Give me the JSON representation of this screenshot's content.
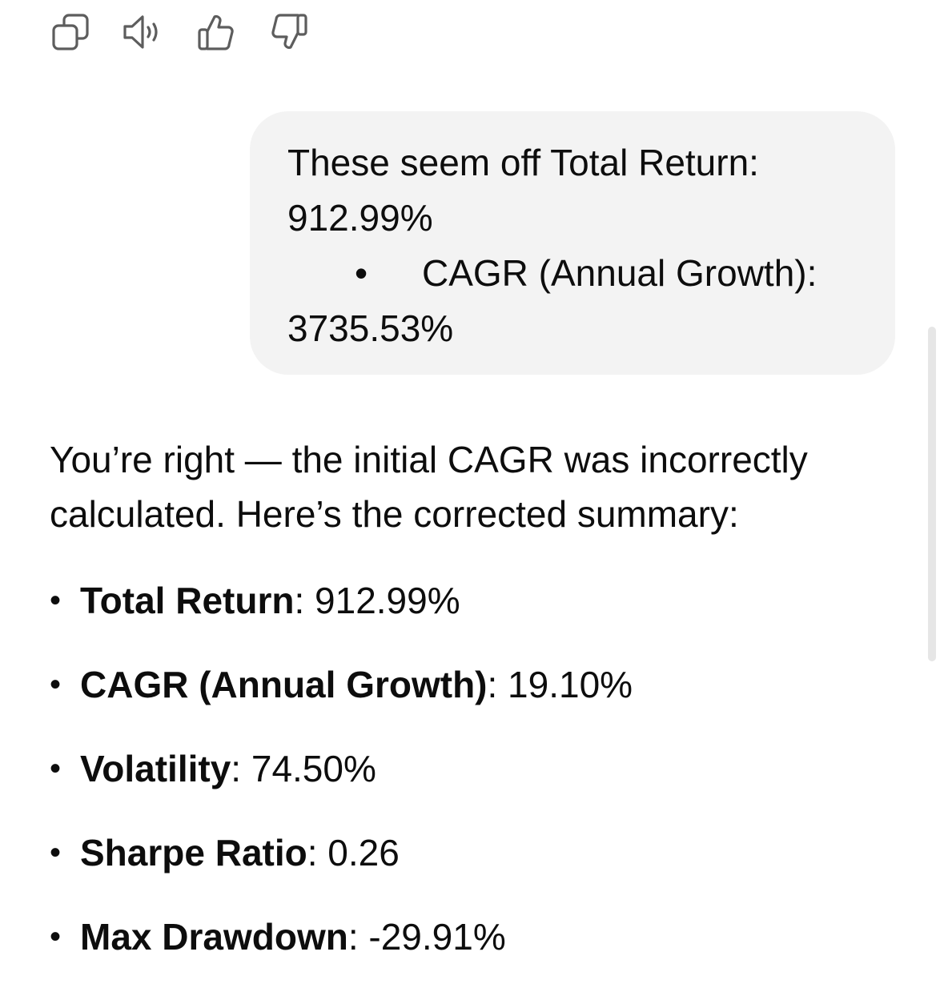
{
  "actions": [
    {
      "name": "copy-button",
      "icon": "copy-icon"
    },
    {
      "name": "read-aloud-button",
      "icon": "speaker-icon"
    },
    {
      "name": "thumbs-up-button",
      "icon": "thumbs-up-icon"
    },
    {
      "name": "thumbs-down-button",
      "icon": "thumbs-down-icon"
    }
  ],
  "user_message": {
    "line1": "These seem off Total Return:",
    "line2": "912.99%",
    "bullet": "•",
    "line3": "CAGR (Annual Growth):",
    "line4": "3735.53%"
  },
  "assistant_message": {
    "intro": "You’re right — the initial CAGR was incorrectly calculated. Here’s the corrected summary:",
    "bullet": "•",
    "items": [
      {
        "label": "Total Return",
        "value": ": 912.99%"
      },
      {
        "label": "CAGR (Annual Growth)",
        "value": ": 19.10%"
      },
      {
        "label": "Volatility",
        "value": ": 74.50%"
      },
      {
        "label": "Sharpe Ratio",
        "value": ": 0.26"
      },
      {
        "label": "Max Drawdown",
        "value": ": -29.91%"
      }
    ]
  },
  "colors": {
    "text": "#0d0d0d",
    "bubble": "#f3f3f3",
    "icon": "#5d5d5d",
    "scrollbar": "#e6e6e6"
  }
}
